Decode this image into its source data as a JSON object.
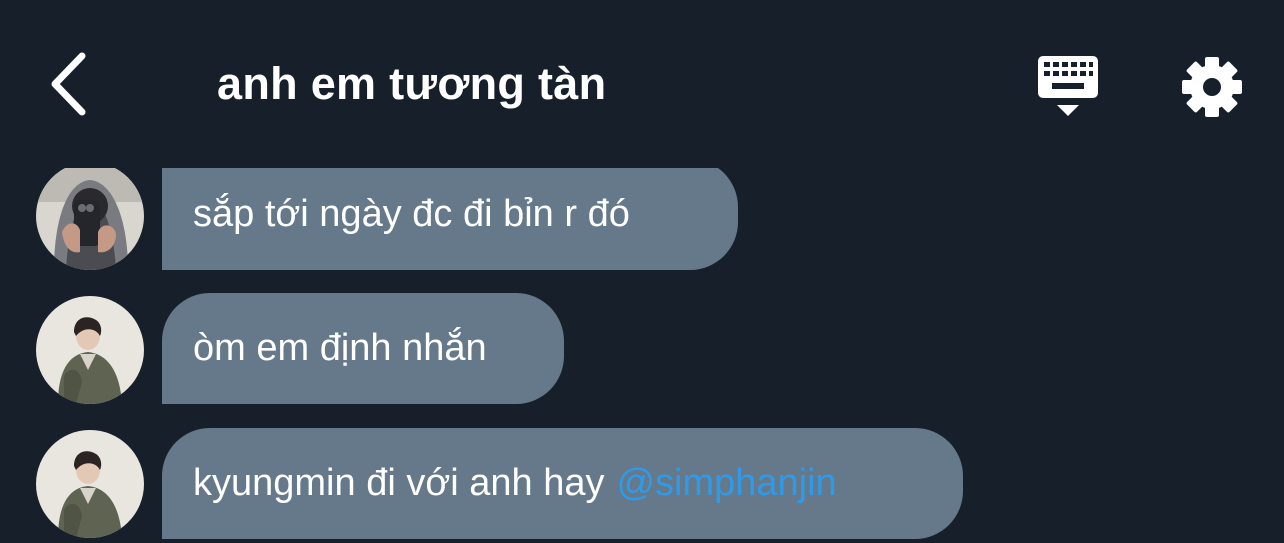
{
  "header": {
    "title": "anh em tương tàn",
    "back_icon": "chevron-left-icon",
    "keyboard_icon": "keyboard-icon",
    "settings_icon": "gear-icon"
  },
  "messages": [
    {
      "avatar": "avatar-user-hoodie-phone",
      "text": "sắp tới ngày đc đi bỉn r đó"
    },
    {
      "avatar": "avatar-user-jacket",
      "text": "òm em định nhắn"
    },
    {
      "avatar": "avatar-user-jacket",
      "text": "kyungmin đi với anh hay",
      "mention": "@simphanjin"
    }
  ],
  "colors": {
    "background": "#17202a",
    "bubble": "#65798a",
    "mention": "#2d9be9",
    "text": "#ffffff"
  }
}
